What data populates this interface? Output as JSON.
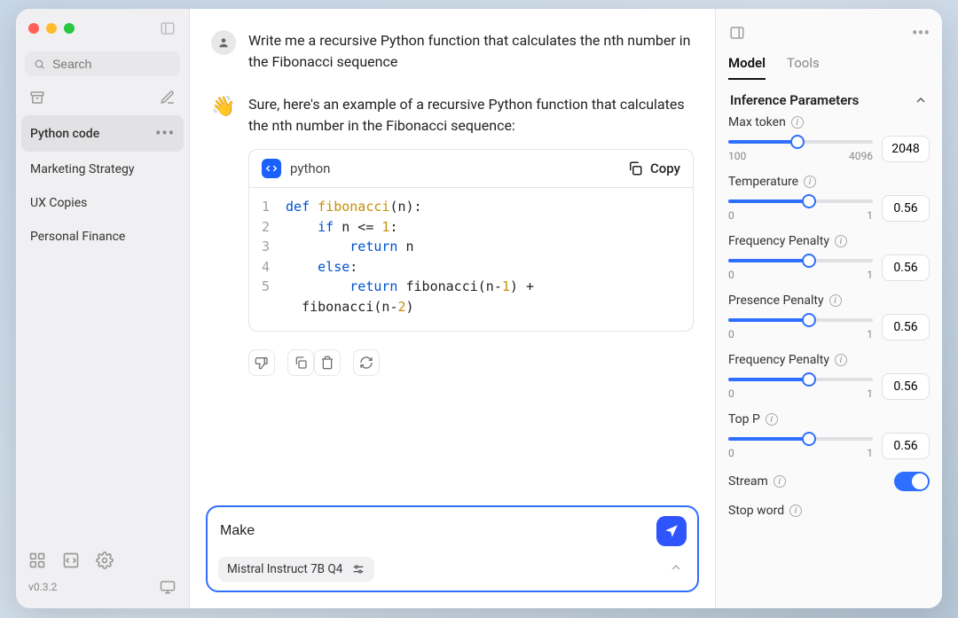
{
  "sidebar": {
    "search_placeholder": "Search",
    "items": [
      {
        "label": "Python code",
        "active": true
      },
      {
        "label": "Marketing Strategy",
        "active": false
      },
      {
        "label": "UX Copies",
        "active": false
      },
      {
        "label": "Personal Finance",
        "active": false
      }
    ],
    "version": "v0.3.2"
  },
  "chat": {
    "user_msg": "Write me a recursive Python function that calculates the nth number in the Fibonacci sequence",
    "bot_intro": "Sure, here's an example of a recursive Python function that calculates the nth number in the Fibonacci sequence:",
    "code_lang": "python",
    "copy_label": "Copy",
    "code_lines": [
      "1",
      "2",
      "3",
      "4",
      "5"
    ]
  },
  "composer": {
    "input_value": "Make",
    "model_name": "Mistral Instruct 7B Q4"
  },
  "rp": {
    "tabs": {
      "model": "Model",
      "tools": "Tools"
    },
    "section": "Inference Parameters",
    "params": {
      "max_token": {
        "label": "Max token",
        "min": "100",
        "max": "4096",
        "value": "2048",
        "fill": 48
      },
      "temperature": {
        "label": "Temperature",
        "min": "0",
        "max": "1",
        "value": "0.56",
        "fill": 56
      },
      "freq_penalty": {
        "label": "Frequency Penalty",
        "min": "0",
        "max": "1",
        "value": "0.56",
        "fill": 56
      },
      "presence_penalty": {
        "label": "Presence Penalty",
        "min": "0",
        "max": "1",
        "value": "0.56",
        "fill": 56
      },
      "freq_penalty2": {
        "label": "Frequency Penalty",
        "min": "0",
        "max": "1",
        "value": "0.56",
        "fill": 56
      },
      "top_p": {
        "label": "Top P",
        "min": "0",
        "max": "1",
        "value": "0.56",
        "fill": 56
      }
    },
    "stream_label": "Stream",
    "stop_word_label": "Stop word"
  }
}
